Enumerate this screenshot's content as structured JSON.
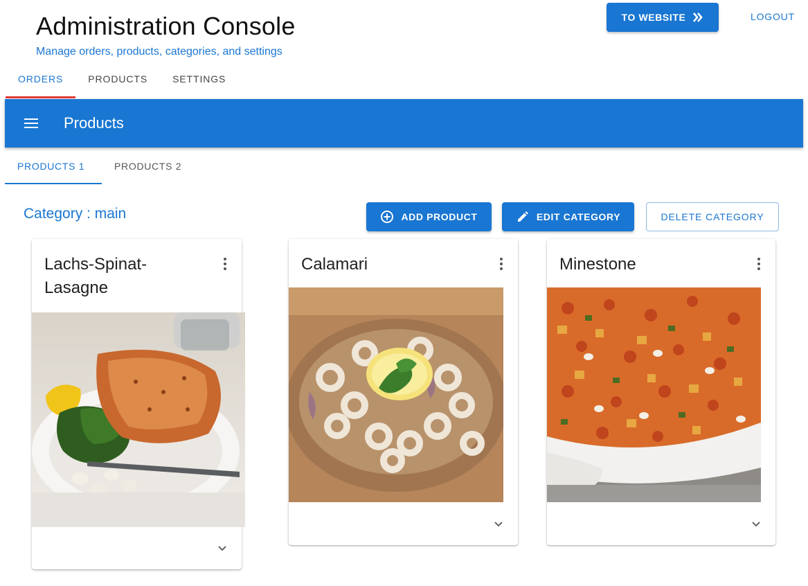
{
  "header": {
    "title": "Administration Console",
    "subtitle": "Manage orders, products, categories, and settings",
    "website_button": "TO WEBSITE",
    "logout_button": "LOGOUT"
  },
  "main_tabs": [
    {
      "label": "ORDERS",
      "active": true
    },
    {
      "label": "PRODUCTS",
      "active": false
    },
    {
      "label": "SETTINGS",
      "active": false
    }
  ],
  "toolbar": {
    "title": "Products",
    "menu_icon": "menu-icon"
  },
  "sub_tabs": [
    {
      "label": "PRODUCTS 1",
      "active": true
    },
    {
      "label": "PRODUCTS 2",
      "active": false
    }
  ],
  "category": {
    "label": "Category : main"
  },
  "actions": {
    "add_product": "ADD PRODUCT",
    "edit_category": "EDIT CATEGORY",
    "delete_category": "DELETE CATEGORY"
  },
  "products": [
    {
      "name": "Lachs-Spinat-Lasagne",
      "image": "salmon with spinach and white beans on a plate"
    },
    {
      "name": "Calamari",
      "image": "fried calamari rings with lemon and parsley"
    },
    {
      "name": "Minestone",
      "image": "vegetable minestrone soup in a white pot"
    }
  ],
  "colors": {
    "primary": "#1976d2",
    "tab_indicator": "#e53935"
  }
}
